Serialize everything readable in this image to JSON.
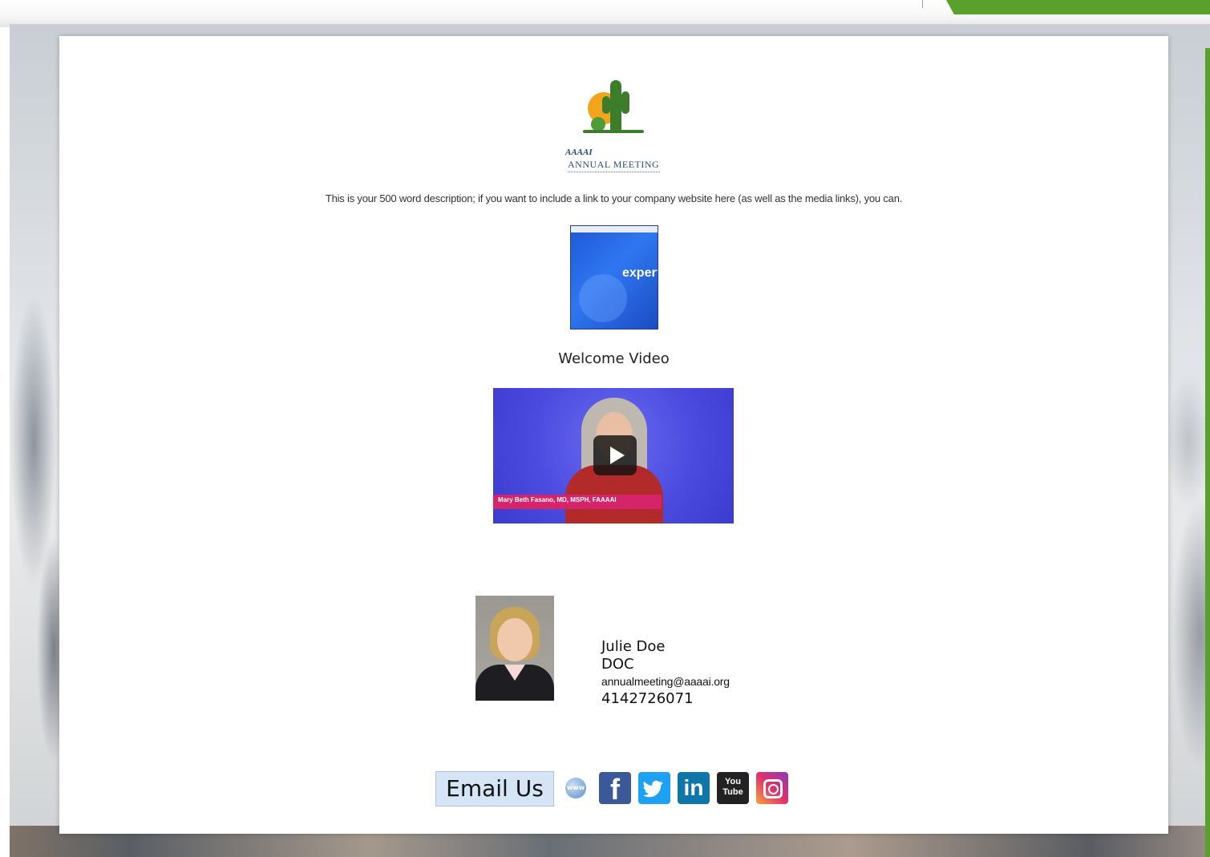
{
  "logo": {
    "brand": "AAAAI",
    "title": "ANNUAL MEETING"
  },
  "description": "This is your 500 word description; if you want to include a link to your company website here (as well as the media links), you can.",
  "brochure": {
    "word": "expert"
  },
  "video": {
    "title": "Welcome Video",
    "caption": "Mary Beth Fasano, MD, MSPH, FAAAAI"
  },
  "contact": {
    "name": "Julie Doe",
    "role": "DOC",
    "email": "annualmeeting@aaaai.org",
    "phone": "4142726071"
  },
  "footer": {
    "email_button": "Email Us",
    "www_label": "www",
    "facebook": "f",
    "twitter": "t",
    "linkedin": "in",
    "youtube": "You Tube"
  },
  "colors": {
    "accent_green": "#5aa02c",
    "email_button_bg": "#d5e5f5",
    "facebook": "#3b5998",
    "twitter": "#1da1f2",
    "linkedin": "#0e76a8"
  }
}
